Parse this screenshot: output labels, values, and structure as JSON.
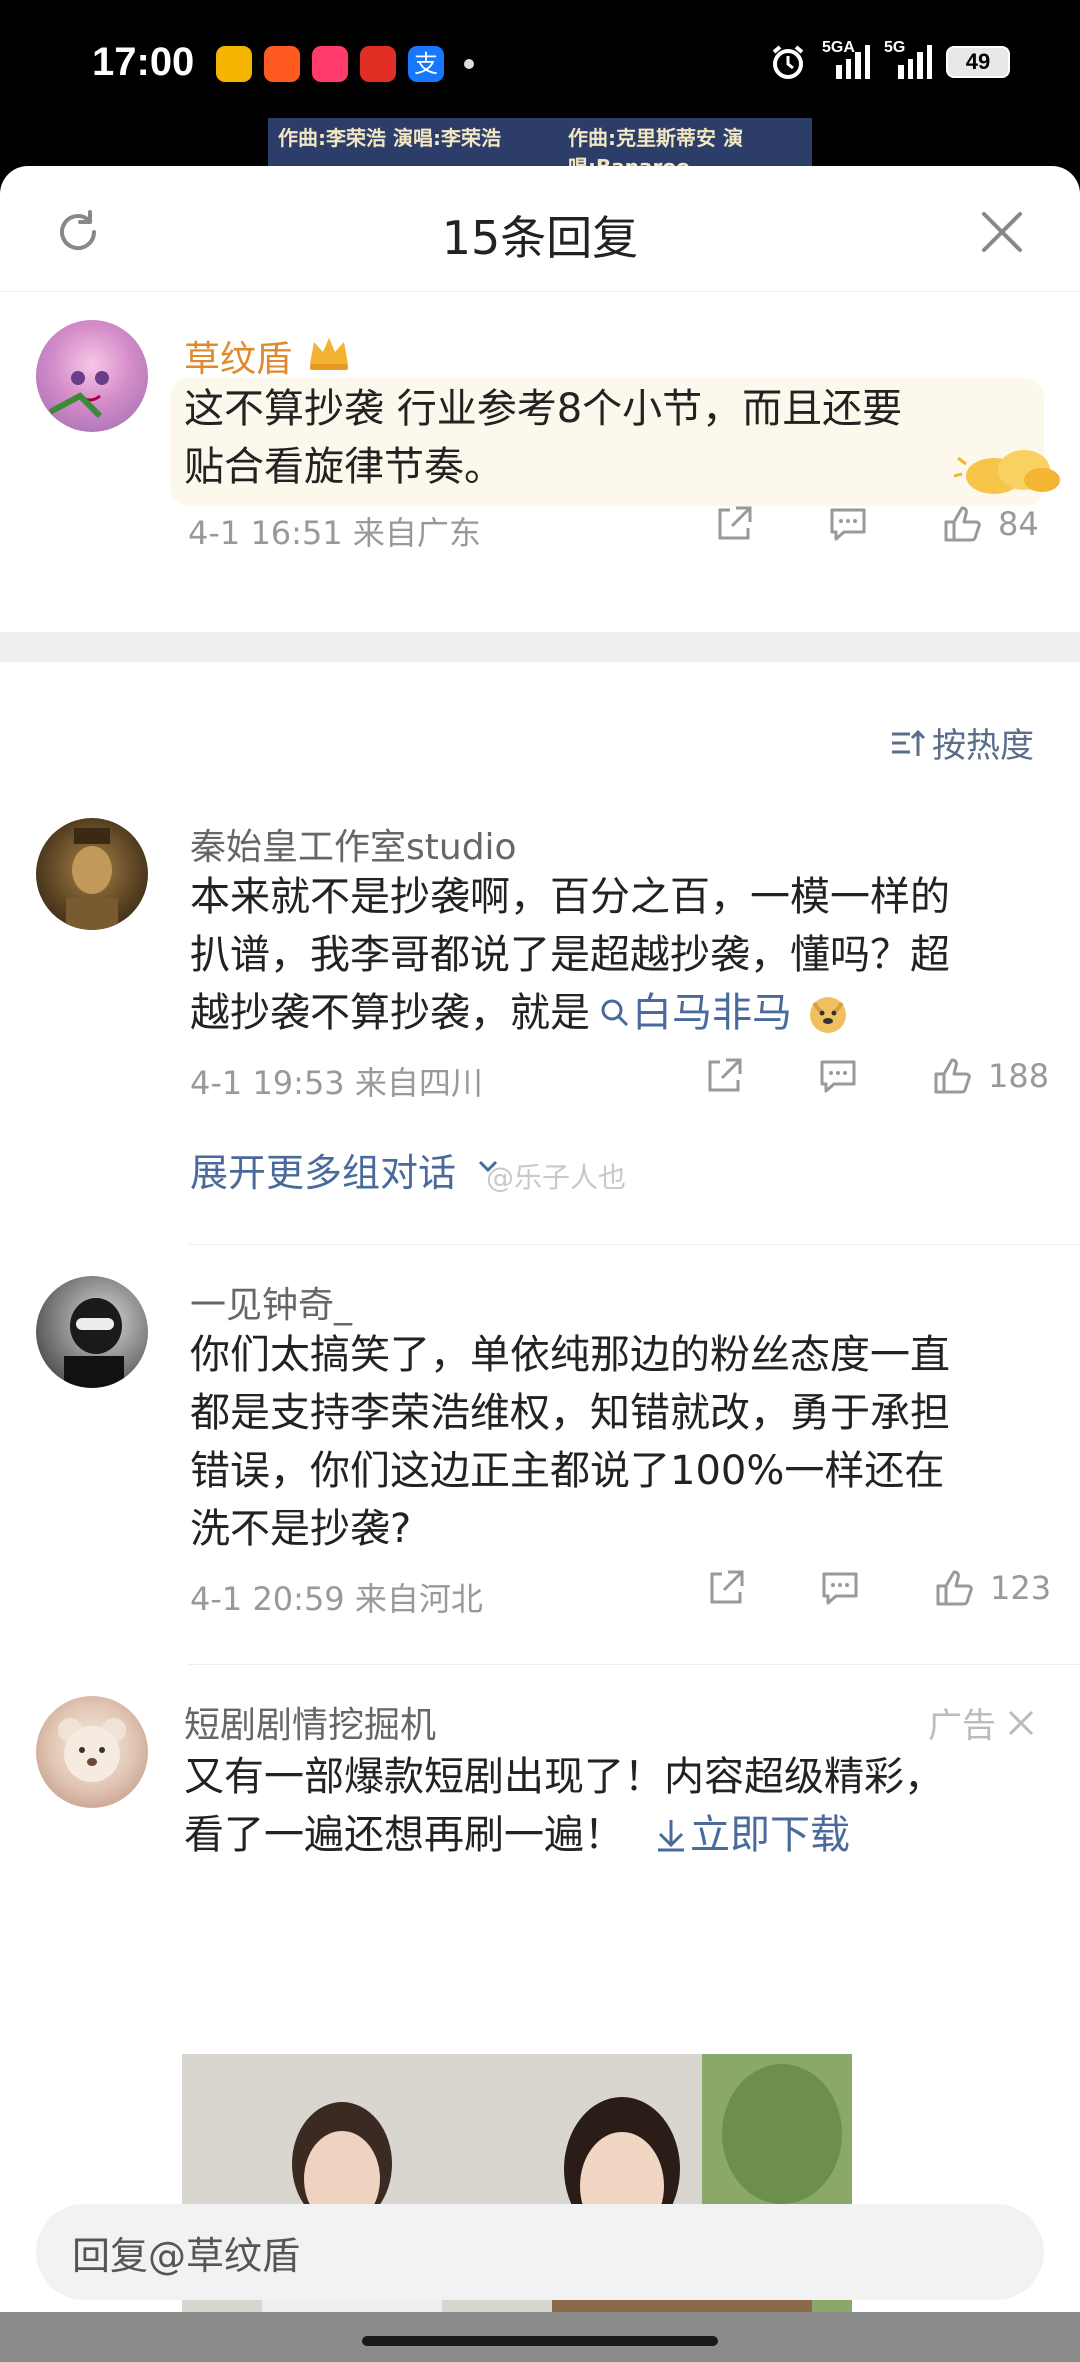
{
  "status_bar": {
    "time": "17:00",
    "signal1": "5GA",
    "signal2": "5G",
    "battery": "49"
  },
  "video": {
    "left_text": "作曲:李荣浩 演唱:李荣浩",
    "right_text": "作曲:克里斯蒂安 演唱:Banaroo"
  },
  "header": {
    "title": "15条回复"
  },
  "root_comment": {
    "user": "草纹盾",
    "text_line1": "这不算抄袭 行业参考8个小节，而且还要",
    "text_line2": "贴合看旋律节奏。",
    "meta": "4-1 16:51 来自广东",
    "likes": "84"
  },
  "sort_label": "按热度",
  "replies": [
    {
      "user": "秦始皇工作室studio",
      "text_line1": "本来就不是抄袭啊，百分之百，一模一样的",
      "text_line2": "扒谱，我李哥都说了是超越抄袭，懂吗？超",
      "text_line3": "越抄袭不算抄袭，就是",
      "link": "白马非马",
      "meta": "4-1 19:53 来自四川",
      "likes": "188",
      "expand": "展开更多组对话"
    },
    {
      "user": "一见钟奇_",
      "text_line1": "你们太搞笑了，单依纯那边的粉丝态度一直",
      "text_line2": "都是支持李荣浩维权，知错就改，勇于承担",
      "text_line3": "错误，你们这边正主都说了100%一样还在",
      "text_line4": "洗不是抄袭?",
      "meta": "4-1 20:59 来自河北",
      "likes": "123"
    }
  ],
  "watermark": "@乐子人也",
  "ad": {
    "user": "短剧剧情挖掘机",
    "tag": "广告",
    "text_line1": "又有一部爆款短剧出现了！内容超级精彩，",
    "text_line2": "看了一遍还想再刷一遍！",
    "download": "立即下载"
  },
  "reply_box": {
    "placeholder": "回复@草纹盾"
  },
  "colors": {
    "link": "#4a6a9c",
    "vip_name": "#e08a2c",
    "meta": "#999999"
  }
}
